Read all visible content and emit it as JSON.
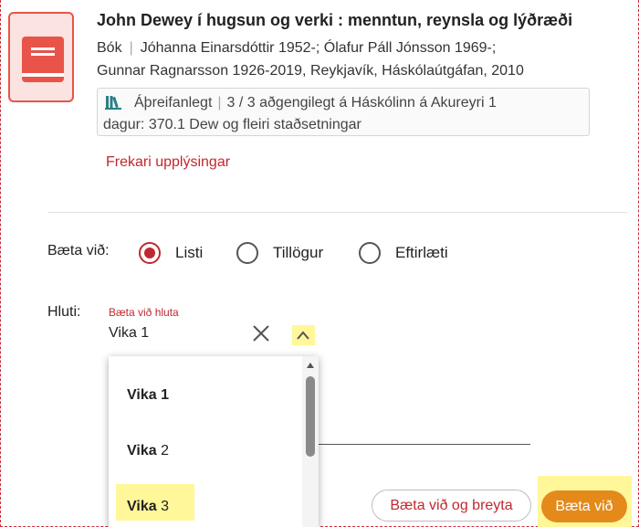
{
  "record": {
    "title": "John Dewey í hugsun og verki : menntun, reynsla og lýðræði",
    "format": "Bók",
    "authors_line1": "Jóhanna Einarsdóttir 1952-; Ólafur Páll Jónsson 1969-;",
    "authors_line2": "Gunnar Ragnarsson 1926-2019, Reykjavík, Háskólaútgáfan, 2010",
    "availability_status": "Áþreifanlegt",
    "availability_detail": "3 / 3 aðgengilegt á Háskólinn á Akureyri 1",
    "availability_detail2": "dagur: 370.1 Dew og fleiri staðsetningar",
    "more_info_link": "Frekari upplýsingar"
  },
  "add_to": {
    "label": "Bæta við:",
    "options": [
      {
        "label": "Listi",
        "selected": true
      },
      {
        "label": "Tillögur",
        "selected": false
      },
      {
        "label": "Eftirlæti",
        "selected": false
      }
    ]
  },
  "parts": {
    "label": "Hluti:",
    "field_label": "Bæta við hluta",
    "field_value": "Vika 1",
    "dropdown_options": [
      {
        "prefix": "Vika",
        "suffix": " 1",
        "bold_suffix": true
      },
      {
        "prefix": "Vika",
        "suffix": " 2",
        "bold_suffix": false
      },
      {
        "prefix": "Vika",
        "suffix": " 3",
        "bold_suffix": false
      }
    ]
  },
  "actions": {
    "add_and_edit": "Bæta við og breyta",
    "add": "Bæta við"
  },
  "colors": {
    "accent_red": "#c0282f",
    "primary_button": "#e48a1b",
    "highlight": "#fff79a"
  },
  "icons": {
    "book": "book-icon",
    "library": "library-icon",
    "clear": "close-icon",
    "toggle": "chevron-up-icon"
  }
}
